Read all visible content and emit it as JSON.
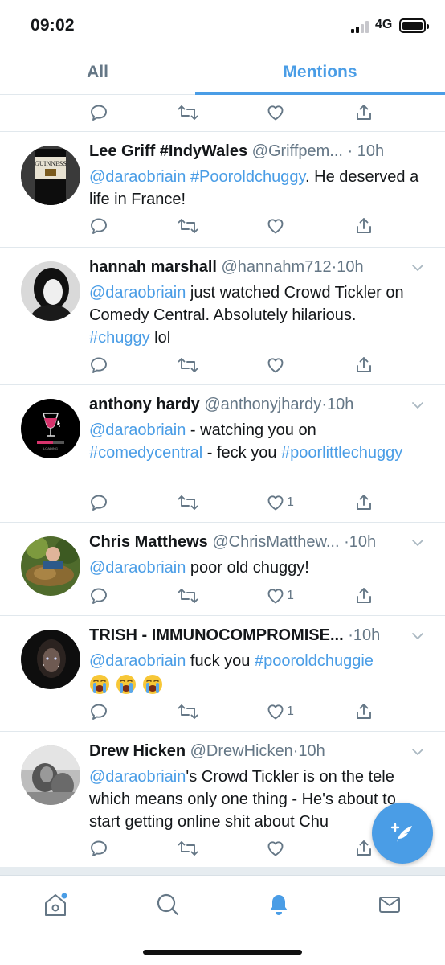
{
  "status_bar": {
    "time": "09:02",
    "network": "4G"
  },
  "tabs": [
    {
      "label": "All",
      "active": false
    },
    {
      "label": "Mentions",
      "active": true
    }
  ],
  "colors": {
    "accent": "#4a9de6",
    "secondary_text": "#657786",
    "divider": "#e1e8ed"
  },
  "tweets": [
    {
      "name": "Lee Griff #IndyWales",
      "handle": "@Griffpem...",
      "dot": "·",
      "time": "10h",
      "text": [
        {
          "t": "@daraobriain",
          "link": true
        },
        {
          "t": " ",
          "link": false
        },
        {
          "t": "#Pooroldchuggy",
          "link": true
        },
        {
          "t": ". He deserved a life in France!",
          "link": false
        }
      ],
      "likes": "",
      "avatar_logo": "GUINNESS"
    },
    {
      "name": "hannah marshall",
      "handle": "@hannahm712",
      "dot": "·",
      "time": "10h",
      "text": [
        {
          "t": "@daraobriain",
          "link": true
        },
        {
          "t": " just watched Crowd Tickler on Comedy Central. Absolutely hilarious. ",
          "link": false
        },
        {
          "t": "#chuggy",
          "link": true
        },
        {
          "t": " lol",
          "link": false
        }
      ],
      "likes": ""
    },
    {
      "name": "anthony hardy",
      "handle": "@anthonyjhardy",
      "dot": "·",
      "time": "10h",
      "text": [
        {
          "t": "@daraobriain",
          "link": true
        },
        {
          "t": " - watching you on ",
          "link": false
        },
        {
          "t": "#comedycentral",
          "link": true
        },
        {
          "t": " - feck you ",
          "link": false
        },
        {
          "t": "#poorlittlechuggy",
          "link": true
        }
      ],
      "likes": "1",
      "avatar_caption": "LOADING"
    },
    {
      "name": "Chris Matthews",
      "handle": "@ChrisMatthew...",
      "dot": "·",
      "time": "10h",
      "text": [
        {
          "t": "@daraobriain",
          "link": true
        },
        {
          "t": " poor old chuggy!",
          "link": false
        }
      ],
      "likes": "1"
    },
    {
      "name": "TRISH - IMMUNOCOMPROMISE...",
      "handle": "",
      "dot": "·",
      "time": "10h",
      "text": [
        {
          "t": "@daraobriain",
          "link": true
        },
        {
          "t": " fuck you ",
          "link": false
        },
        {
          "t": "#pooroldchuggie",
          "link": true
        }
      ],
      "emoji": [
        "loudly-crying-face",
        "loudly-crying-face",
        "loudly-crying-face"
      ],
      "likes": "1"
    },
    {
      "name": "Drew Hicken",
      "handle": "@DrewHicken",
      "dot": "·",
      "time": "10h",
      "text": [
        {
          "t": "@daraobriain",
          "link": true
        },
        {
          "t": "'s Crowd Tickler is on the tele which means only one thing - He's about to start getting online shit about Chu",
          "link": false
        }
      ],
      "likes": ""
    }
  ],
  "icons": {
    "reply": "reply-icon",
    "retweet": "retweet-icon",
    "like": "heart-icon",
    "share": "share-icon",
    "compose": "compose-tweet-icon",
    "nav": [
      "home-icon",
      "search-icon",
      "notifications-bell-icon",
      "messages-envelope-icon"
    ]
  }
}
